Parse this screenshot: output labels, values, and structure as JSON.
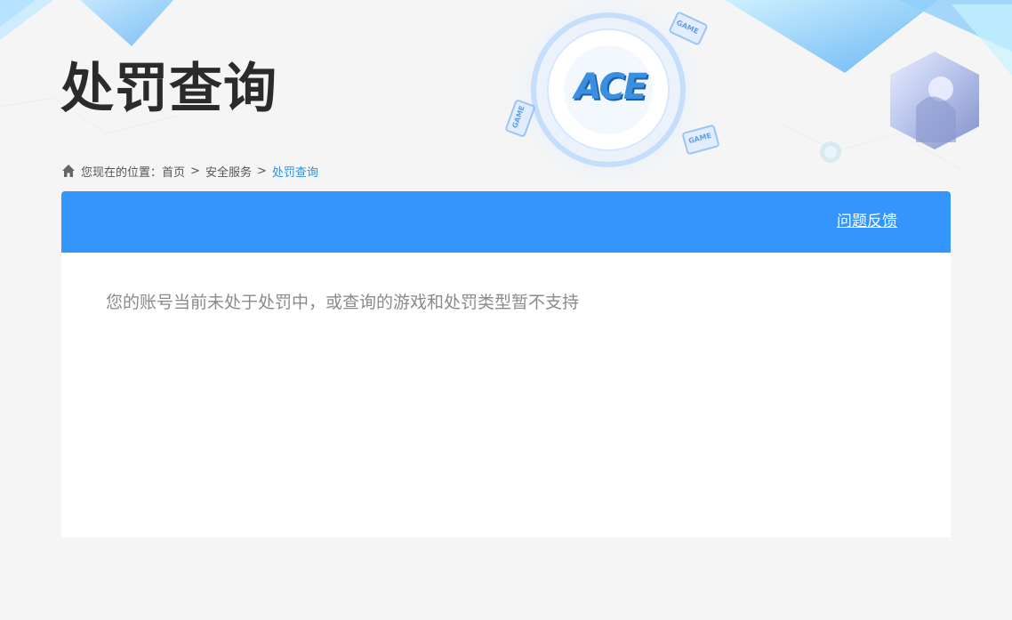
{
  "header": {
    "title": "处罚查询",
    "logo_text": "ACE",
    "badge_text": "GAME"
  },
  "breadcrumb": {
    "prefix": "您现在的位置：",
    "items": [
      "首页",
      "安全服务"
    ],
    "separator": ">",
    "current": "处罚查询"
  },
  "panel": {
    "feedback_label": "问题反馈",
    "message": "您的账号当前未处于处罚中，或查询的游戏和处罚类型暂不支持"
  },
  "colors": {
    "accent": "#3496fd",
    "breadcrumb_current": "#2b8fe8",
    "background": "#f5f5f5",
    "message_text": "#8a8a8a"
  }
}
